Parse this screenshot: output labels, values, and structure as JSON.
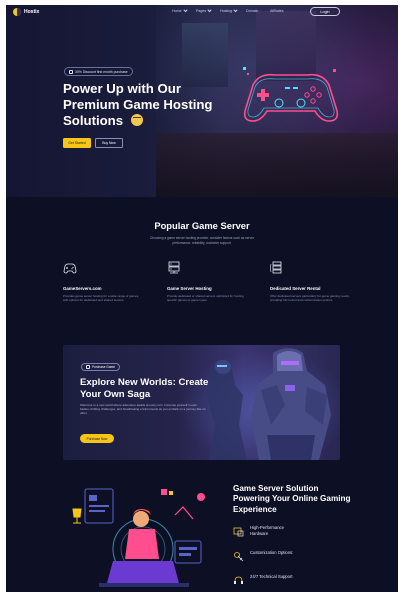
{
  "nav": {
    "brand": "Hostix",
    "menu": [
      {
        "label": "Home",
        "dropdown": true
      },
      {
        "label": "Pages",
        "dropdown": true
      },
      {
        "label": "Hosting",
        "dropdown": true
      },
      {
        "label": "Domain",
        "dropdown": false
      },
      {
        "label": "Affiliates",
        "dropdown": false
      }
    ],
    "login_label": "Login"
  },
  "hero": {
    "badge": "30% Discount first month purchase",
    "title": "Power Up with Our Premium Game Hosting Solutions",
    "get_started": "Get Started",
    "buy_now": "Buy Now"
  },
  "popular": {
    "title": "Popular Game Server",
    "subtitle": "Choosing a game server hosting provider, consider factors such as server performance, reliability, customer support.",
    "features": [
      {
        "icon": "gamepad-icon",
        "title": "GameServers.com",
        "desc": "Provides game server hosting for a wide range of games, with options for dedicated and shared servers."
      },
      {
        "icon": "server-icon",
        "title": "Game Server Hosting",
        "desc": "Provide dedicated or shared servers optimized for hosting specific games or game types."
      },
      {
        "icon": "rack-icon",
        "title": "Dedicated Server Rental",
        "desc": "Offer dedicated servers particularly for game gaming needs, providing full control and customization options."
      }
    ]
  },
  "banner": {
    "tag": "Purchase Game",
    "title": "Explore New Worlds: Create Your Own Saga",
    "desc": "Welcome to a new world where adventure awaits at every turn. Immerse yourself in epic battles, thrilling challenges, and breathtaking environments as you embark on a journey like no other.",
    "button": "Purchase Now"
  },
  "solution": {
    "title": "Game Server Solution Powering Your Online Gaming Experience",
    "items": [
      {
        "icon": "hardware-icon",
        "label": "High-Performance Hardware"
      },
      {
        "icon": "customize-icon",
        "label": "Customization Options:"
      },
      {
        "icon": "support-icon",
        "label": "24/7 Technical Support"
      }
    ]
  },
  "colors": {
    "background": "#0d1024",
    "accent": "#f5c518",
    "neon_pink": "#ff4d8d",
    "neon_cyan": "#4de1ff"
  }
}
